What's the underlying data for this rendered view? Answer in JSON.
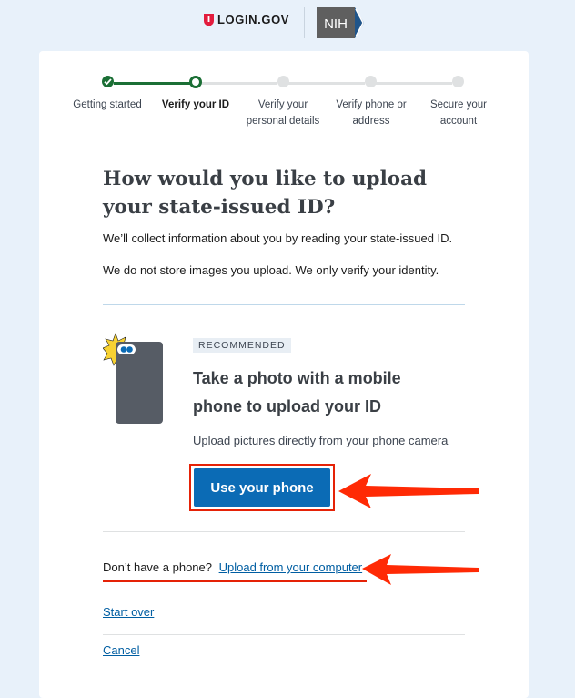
{
  "header": {
    "brand_name": "LOGIN.GOV",
    "partner_logo_text": "NIH"
  },
  "steps": [
    {
      "label": "Getting started",
      "status": "complete"
    },
    {
      "label": "Verify your ID",
      "status": "current"
    },
    {
      "label": "Verify your personal details",
      "status": "upcoming"
    },
    {
      "label": "Verify phone or address",
      "status": "upcoming"
    },
    {
      "label": "Secure your account",
      "status": "upcoming"
    }
  ],
  "page": {
    "title": "How would you like to upload your state-issued ID?",
    "intro_1": "We’ll collect information about you by reading your state-issued ID.",
    "intro_2": "We do not store images you upload. We only verify your identity."
  },
  "phone_option": {
    "tag": "RECOMMENDED",
    "title": "Take a photo with a mobile phone to upload your ID",
    "description": "Upload pictures directly from your phone camera",
    "button_label": "Use your phone"
  },
  "computer_option": {
    "prompt": "Don’t have a phone?",
    "link_label": "Upload from your computer"
  },
  "footer": {
    "start_over": "Start over",
    "cancel": "Cancel"
  },
  "colors": {
    "brand_green": "#1b6f35",
    "primary_blue": "#0b6bb5",
    "link_blue": "#005ea2",
    "annotation_red": "#e52207",
    "page_background": "#e8f1fa"
  }
}
